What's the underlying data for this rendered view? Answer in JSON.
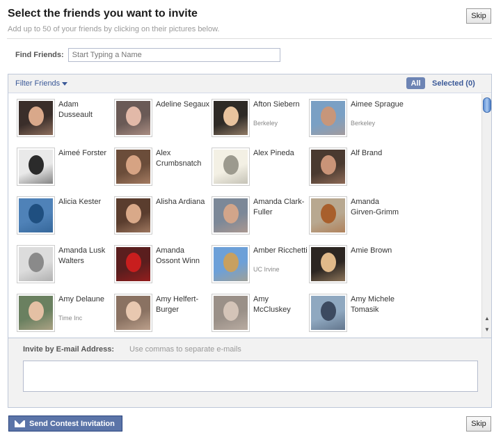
{
  "header": {
    "title": "Select the friends you want to invite",
    "subtitle": "Add up to 50 of your friends by clicking on their pictures below.",
    "skip_label": "Skip"
  },
  "find": {
    "label": "Find Friends:",
    "placeholder": "Start Typing a Name"
  },
  "filter": {
    "filter_label": "Filter Friends",
    "all_label": "All",
    "selected_label": "Selected (0)"
  },
  "friends": [
    {
      "name": "Adam Dusseault",
      "network": "",
      "photo": {
        "bg": "#3a2e2a",
        "skin": "#d9a88a"
      }
    },
    {
      "name": "Adeline Segaux",
      "network": "",
      "photo": {
        "bg": "#6a5a56",
        "skin": "#e2b9a8"
      }
    },
    {
      "name": "Afton Siebern",
      "network": "Berkeley",
      "photo": {
        "bg": "#2e2a26",
        "skin": "#e8c39e"
      }
    },
    {
      "name": "Aimee Sprague",
      "network": "Berkeley",
      "photo": {
        "bg": "#7aa0c4",
        "skin": "#c7967a"
      }
    },
    {
      "name": "Aimeé Forster",
      "network": "",
      "photo": {
        "bg": "#e9e9e9",
        "skin": "#2b2b2b"
      }
    },
    {
      "name": "Alex Crumbsnatch",
      "network": "",
      "photo": {
        "bg": "#6b4d3a",
        "skin": "#d6a383"
      }
    },
    {
      "name": "Alex Pineda",
      "network": "",
      "photo": {
        "bg": "#f3f0e4",
        "skin": "#9c9a8e"
      }
    },
    {
      "name": "Alf Brand",
      "network": "",
      "photo": {
        "bg": "#4a3a30",
        "skin": "#c99478"
      }
    },
    {
      "name": "Alicia Kester",
      "network": "",
      "photo": {
        "bg": "#4f82b8",
        "skin": "#1f4f80"
      }
    },
    {
      "name": "Alisha Ardiana",
      "network": "",
      "photo": {
        "bg": "#5a3d2e",
        "skin": "#d9a989"
      }
    },
    {
      "name": "Amanda Clark-Fuller",
      "network": "",
      "photo": {
        "bg": "#7c8898",
        "skin": "#d2a58a"
      }
    },
    {
      "name": "Amanda Girven-Grimm",
      "network": "",
      "photo": {
        "bg": "#b8a890",
        "skin": "#a85f2c"
      }
    },
    {
      "name": "Amanda Lusk Walters",
      "network": "",
      "photo": {
        "bg": "#dcdcdc",
        "skin": "#8a8a8a"
      }
    },
    {
      "name": "Amanda Ossont Winn",
      "network": "",
      "photo": {
        "bg": "#5a1e1e",
        "skin": "#c81e1e"
      }
    },
    {
      "name": "Amber Ricchetti",
      "network": "UC Irvine",
      "photo": {
        "bg": "#6da0d8",
        "skin": "#c8a060"
      }
    },
    {
      "name": "Amie Brown",
      "network": "",
      "photo": {
        "bg": "#2c2622",
        "skin": "#e0b98a"
      }
    },
    {
      "name": "Amy Delaune",
      "network": "Time Inc",
      "photo": {
        "bg": "#6a8060",
        "skin": "#e4c0a4"
      }
    },
    {
      "name": "Amy Helfert-Burger",
      "network": "",
      "photo": {
        "bg": "#8a7262",
        "skin": "#e8c8b0"
      }
    },
    {
      "name": "Amy McCluskey",
      "network": "",
      "photo": {
        "bg": "#9a9088",
        "skin": "#d4c4b8"
      }
    },
    {
      "name": "Amy Michele Tomasik",
      "network": "",
      "photo": {
        "bg": "#8fa8c0",
        "skin": "#3c4a60"
      }
    }
  ],
  "email": {
    "label": "Invite by E-mail Address:",
    "hint": "Use commas to separate e-mails",
    "value": ""
  },
  "actions": {
    "send_label": "Send Contest Invitation",
    "skip_label": "Skip"
  },
  "colors": {
    "fb_blue": "#3b5998",
    "button_blue": "#5b74a8",
    "pill_blue": "#6d84b4"
  }
}
